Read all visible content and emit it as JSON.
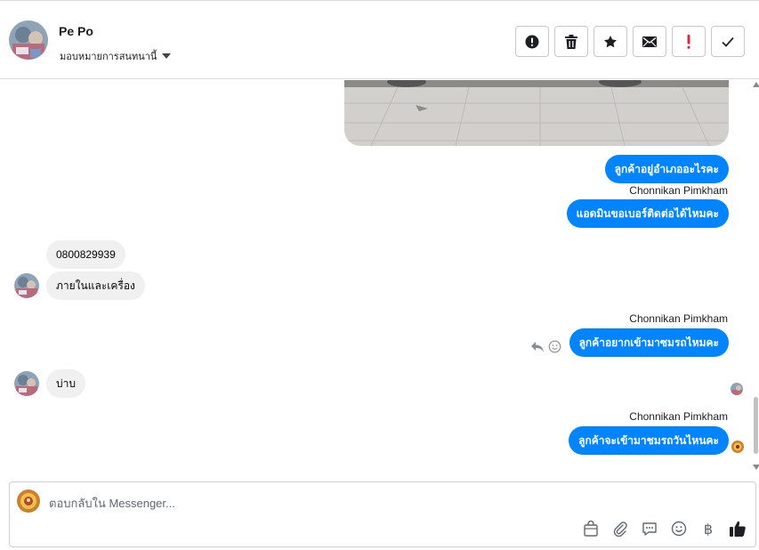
{
  "header": {
    "contact_name": "Pe Po",
    "assign_label": "มอบหมายการสนทนานี้",
    "actions": [
      {
        "name": "spam-button",
        "icon": "alert-circle-icon"
      },
      {
        "name": "delete-button",
        "icon": "trash-icon"
      },
      {
        "name": "star-button",
        "icon": "star-icon"
      },
      {
        "name": "mark-unread-button",
        "icon": "envelope-icon"
      },
      {
        "name": "follow-up-button",
        "icon": "exclamation-icon"
      },
      {
        "name": "done-button",
        "icon": "check-icon"
      }
    ]
  },
  "messages": {
    "out1": "ลูกค้าอยู่อำเภออะไรคะ",
    "sender1": "Chonnikan Pimkham",
    "out2": "แอดมินขอเบอร์ติดต่อได้ไหมคะ",
    "in1": "0800829939",
    "in2": "ภายในและเครื่อง",
    "sender2": "Chonnikan Pimkham",
    "out3": "ลูกค้าอยากเข้ามาซมรถไหมคะ",
    "in3": "บ่าบ",
    "sender3": "Chonnikan Pimkham",
    "out4": "ลูกค้าจะเข้ามาชมรถวันไหนคะ"
  },
  "composer": {
    "placeholder": "ตอบกลับใน Messenger...",
    "tools": [
      "shop-icon",
      "attachment-icon",
      "saved-reply-icon",
      "emoji-icon",
      "baht-icon",
      "thumbs-up-icon"
    ],
    "baht_symbol": "฿"
  },
  "colors": {
    "outgoing_bubble": "#0084ff",
    "incoming_bubble": "#f0f0f0"
  }
}
